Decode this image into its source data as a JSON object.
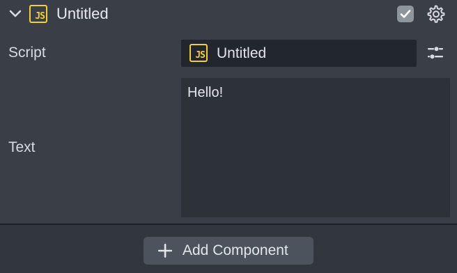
{
  "component": {
    "title": "Untitled",
    "badge_text": "JS",
    "enabled": true,
    "icons": {
      "collapse": "chevron-down-icon",
      "type": "js-file-icon",
      "enabled": "checkbox-checked-icon",
      "settings": "gear-icon"
    }
  },
  "fields": {
    "script": {
      "label": "Script",
      "value": "Untitled",
      "badge_text": "JS",
      "options_icon": "sliders-icon"
    },
    "text": {
      "label": "Text",
      "value": "Hello!"
    }
  },
  "footer": {
    "add_component_label": "Add Component",
    "add_icon": "plus-icon"
  },
  "colors": {
    "panel_bg": "#3a3f47",
    "field_bg": "#22262d",
    "textarea_bg": "#2d3239",
    "js_accent": "#f1cf3c",
    "button_bg": "#4c535c"
  }
}
